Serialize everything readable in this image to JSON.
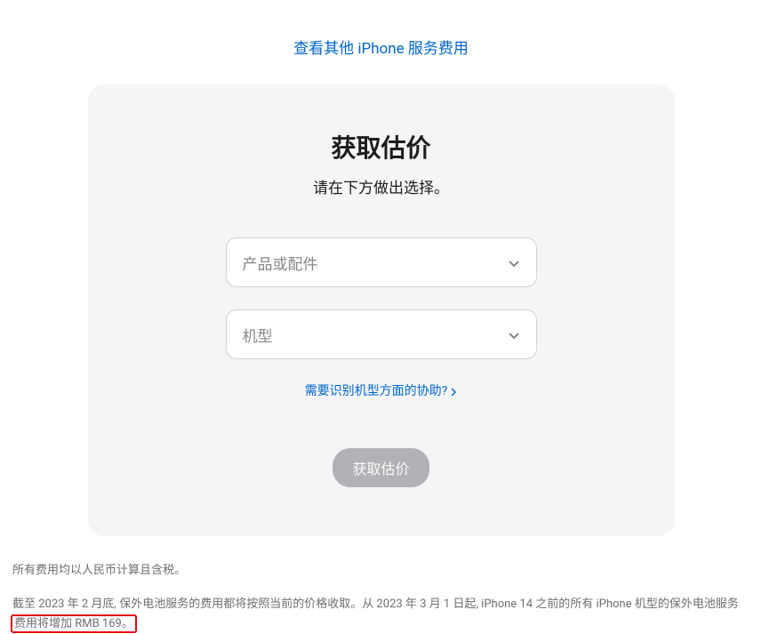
{
  "topLink": {
    "label": "查看其他 iPhone 服务费用"
  },
  "card": {
    "title": "获取估价",
    "subtitle": "请在下方做出选择。",
    "select1": {
      "placeholder": "产品或配件"
    },
    "select2": {
      "placeholder": "机型"
    },
    "helpLink": {
      "label": "需要识别机型方面的协助?"
    },
    "submit": {
      "label": "获取估价"
    }
  },
  "footnote": {
    "line1": "所有费用均以人民币计算且含税。",
    "line2a": "截至 2023 年 2 月底, 保外电池服务的费用都将按照当前的价格收取。从 2023 年 3 月 1 日起, iPhone 14 之前的所有 iPhone 机型的保外电池服务",
    "line2b": "费用将增加 RMB 169。"
  }
}
